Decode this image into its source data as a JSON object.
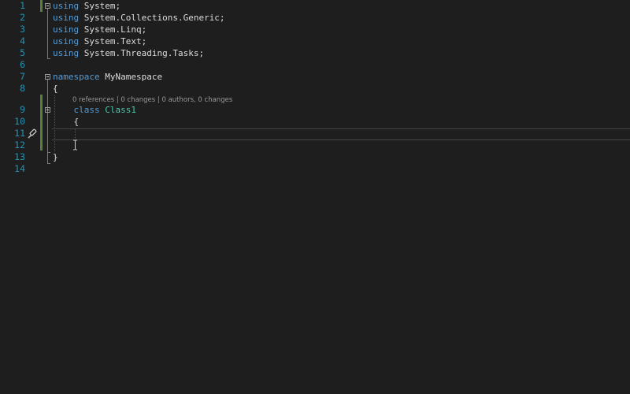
{
  "editor": {
    "lines": [
      {
        "num": "1",
        "tokens": [
          {
            "t": "using",
            "c": "kw"
          },
          {
            "t": " System;",
            "c": "plain"
          }
        ]
      },
      {
        "num": "2",
        "tokens": [
          {
            "t": "using",
            "c": "kw"
          },
          {
            "t": " System.Collections.Generic;",
            "c": "plain"
          }
        ]
      },
      {
        "num": "3",
        "tokens": [
          {
            "t": "using",
            "c": "kw"
          },
          {
            "t": " System.Linq;",
            "c": "plain"
          }
        ]
      },
      {
        "num": "4",
        "tokens": [
          {
            "t": "using",
            "c": "kw"
          },
          {
            "t": " System.Text;",
            "c": "plain"
          }
        ]
      },
      {
        "num": "5",
        "tokens": [
          {
            "t": "using",
            "c": "kw"
          },
          {
            "t": " System.Threading.Tasks;",
            "c": "plain"
          }
        ]
      },
      {
        "num": "6",
        "tokens": []
      },
      {
        "num": "7",
        "tokens": [
          {
            "t": "namespace",
            "c": "kw"
          },
          {
            "t": " MyNamespace",
            "c": "plain"
          }
        ]
      },
      {
        "num": "8",
        "tokens": [
          {
            "t": "{",
            "c": "plain"
          }
        ]
      },
      {
        "num": "9",
        "tokens": [
          {
            "t": "    ",
            "c": "plain"
          },
          {
            "t": "class",
            "c": "kw"
          },
          {
            "t": " ",
            "c": "plain"
          },
          {
            "t": "Class1",
            "c": "type"
          }
        ]
      },
      {
        "num": "10",
        "tokens": [
          {
            "t": "    {",
            "c": "plain"
          }
        ]
      },
      {
        "num": "11",
        "tokens": []
      },
      {
        "num": "12",
        "tokens": []
      },
      {
        "num": "13",
        "tokens": [
          {
            "t": "}",
            "c": "plain"
          }
        ]
      },
      {
        "num": "14",
        "tokens": []
      }
    ],
    "codelens": "0 references | 0 changes | 0 authors, 0 changes",
    "icons": {
      "brush": "paintbrush-icon",
      "cursor": "text-cursor-icon"
    },
    "colors": {
      "background": "#1e1e1e",
      "keyword": "#569cd6",
      "type": "#4ec9b0",
      "line_number": "#2b91af",
      "change_bar": "#57803a"
    }
  }
}
